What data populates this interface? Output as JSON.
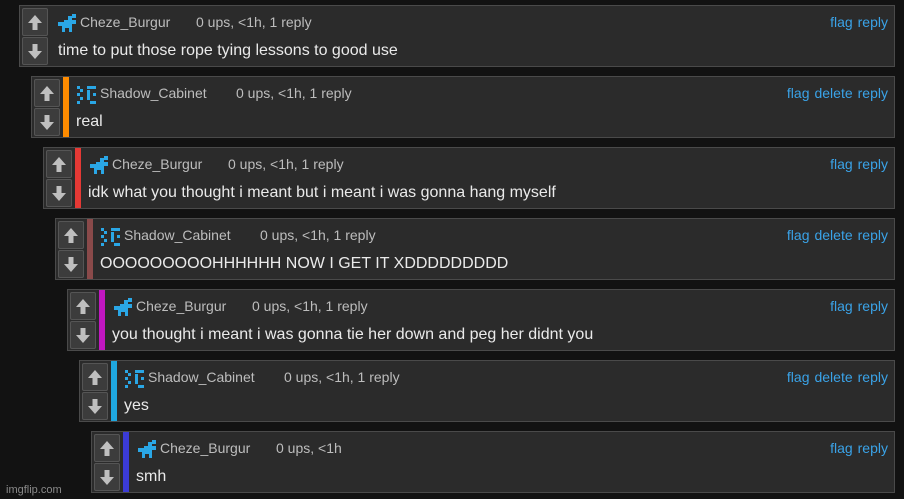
{
  "colors": {
    "link": "#3aa3e8",
    "text": "#eaeaea",
    "meta": "#bdbdbd",
    "panel": "#2b2b2b",
    "accents": [
      "none",
      "#ff8c00",
      "#e53935",
      "#8a4a4a",
      "#c217c2",
      "#1fa8e0",
      "#3b3bd6"
    ]
  },
  "action_labels": {
    "flag": "flag",
    "delete": "delete",
    "reply": "reply"
  },
  "comments": [
    {
      "user": "Cheze_Burgur",
      "meta": "0 ups, <1h, 1 reply",
      "text": "time to put those rope tying lessons to good use",
      "avatar": "cheze-avatar-icon",
      "can_delete": false
    },
    {
      "user": "Shadow_Cabinet",
      "meta": "0 ups, <1h, 1 reply",
      "text": "real",
      "avatar": "shadow-avatar-icon",
      "can_delete": true
    },
    {
      "user": "Cheze_Burgur",
      "meta": "0 ups, <1h, 1 reply",
      "text": "idk what you thought i meant but i meant i was gonna hang myself",
      "avatar": "cheze-avatar-icon",
      "can_delete": false
    },
    {
      "user": "Shadow_Cabinet",
      "meta": "0 ups, <1h, 1 reply",
      "text": "OOOOOOOOOHHHHHH NOW I GET IT XDDDDDDDDD",
      "avatar": "shadow-avatar-icon",
      "can_delete": true
    },
    {
      "user": "Cheze_Burgur",
      "meta": "0 ups, <1h, 1 reply",
      "text": "you thought i meant i was gonna tie her down and peg her didnt you",
      "avatar": "cheze-avatar-icon",
      "can_delete": false
    },
    {
      "user": "Shadow_Cabinet",
      "meta": "0 ups, <1h, 1 reply",
      "text": "yes",
      "avatar": "shadow-avatar-icon",
      "can_delete": true
    },
    {
      "user": "Cheze_Burgur",
      "meta": "0 ups, <1h",
      "text": "smh",
      "avatar": "cheze-avatar-icon",
      "can_delete": false
    }
  ],
  "watermark": "imgflip.com"
}
